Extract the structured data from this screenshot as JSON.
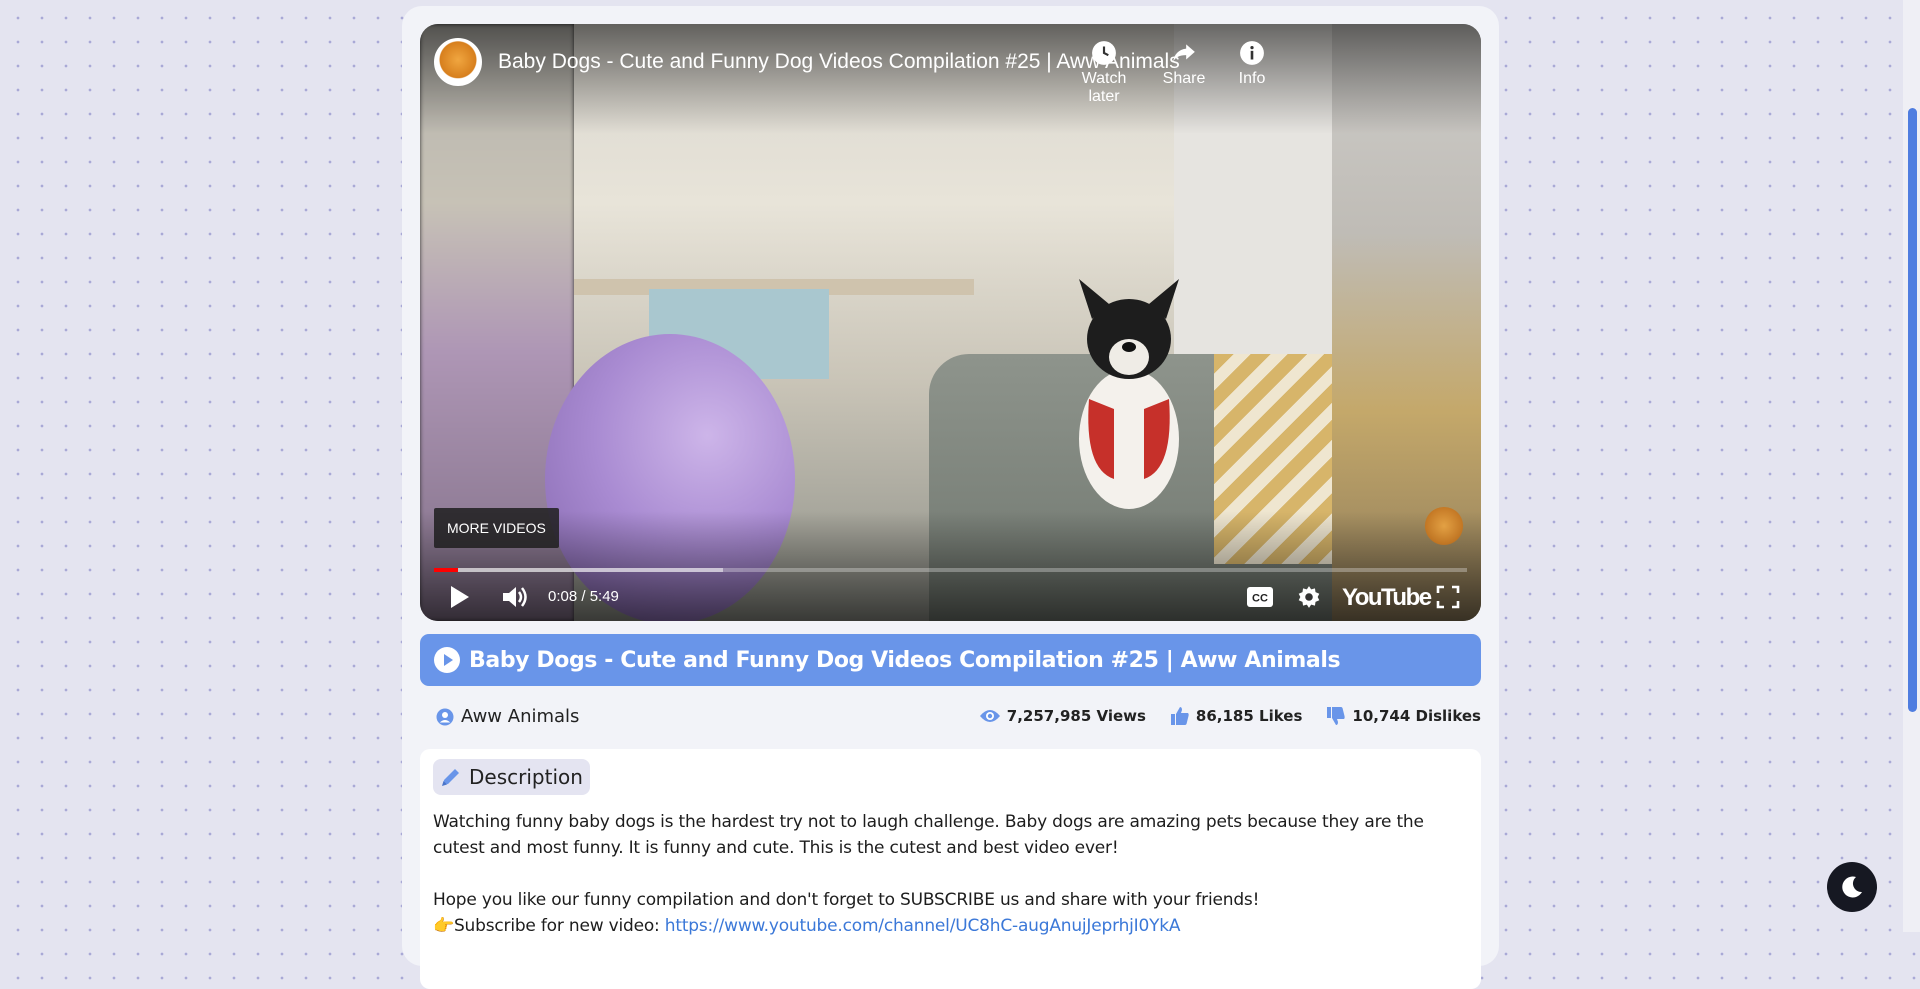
{
  "player": {
    "video_title": "Baby Dogs - Cute and Funny Dog Videos Compilation #25 | Aww Animals",
    "watch_later_label": "Watch later",
    "share_label": "Share",
    "info_label": "Info",
    "more_videos_label": "MORE VIDEOS",
    "time_display": "0:08 / 5:49",
    "youtube_wordmark": "YouTube",
    "progress_played_fraction": 0.023,
    "progress_buffered_fraction": 0.28,
    "progress_color": "#ff0000"
  },
  "video_info": {
    "title": "Baby Dogs - Cute and Funny Dog Videos Compilation #25 | Aww Animals",
    "author": "Aww Animals",
    "views": "7,257,985 Views",
    "likes": "86,185 Likes",
    "dislikes": "10,744 Dislikes"
  },
  "description": {
    "heading": "Description",
    "paragraph1": "Watching funny baby dogs is the hardest try not to laugh challenge. Baby dogs are amazing pets because they are the cutest and most funny. It is funny and cute. This is the cutest and best video ever!",
    "paragraph2": "Hope you like our funny compilation and don't forget to SUBSCRIBE us and share with your friends!",
    "subscribe_prefix": "👉Subscribe for new video: ",
    "subscribe_link": "https://www.youtube.com/channel/UC8hC-augAnujJeprhjI0YkA"
  },
  "colors": {
    "accent": "#6995e9",
    "link": "#3b78d8",
    "page_bg": "#e4e4f0"
  },
  "icons": [
    "channel-logo-icon",
    "clock-icon",
    "share-icon",
    "info-icon",
    "play-icon",
    "volume-icon",
    "captions-icon",
    "settings-icon",
    "fullscreen-icon",
    "play-circle-icon",
    "user-icon",
    "eye-icon",
    "thumbs-up-icon",
    "thumbs-down-icon",
    "pen-icon",
    "moon-icon"
  ]
}
